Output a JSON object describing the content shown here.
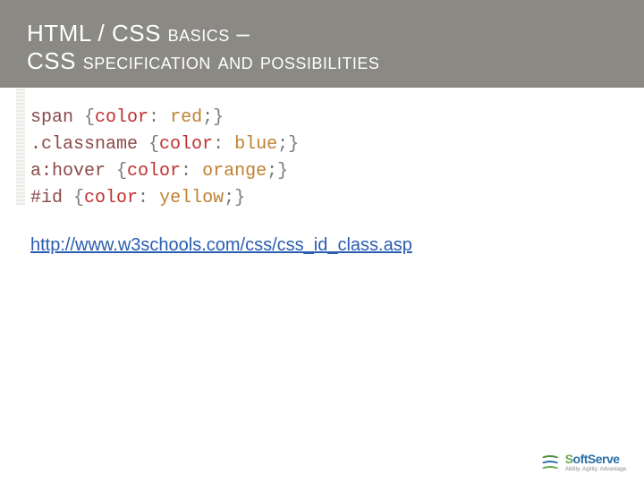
{
  "header": {
    "line1_pre": "HTML / CSS ",
    "line1_sc": "basics",
    "line1_post": " – ",
    "line2_pre": "CSS ",
    "line2_sc": "specification and possibilities"
  },
  "code": {
    "l1": {
      "sel": "span ",
      "open": "{",
      "prop": "color",
      "colon": ": ",
      "val": "red",
      "semi": ";",
      "close": "}"
    },
    "l2": {
      "sel": ".classname ",
      "open": "{",
      "prop": "color",
      "colon": ": ",
      "val": "blue",
      "semi": ";",
      "close": "}"
    },
    "l3": {
      "sel": "a:hover ",
      "open": "{",
      "prop": "color",
      "colon": ": ",
      "val": "orange",
      "semi": ";",
      "close": "}"
    },
    "l4": {
      "sel": "#id ",
      "open": "{",
      "prop": "color",
      "colon": ": ",
      "val": "yellow",
      "semi": ";",
      "close": "}"
    }
  },
  "link": {
    "text": "http://www.w3schools.com/css/css_id_class.asp",
    "href": "http://www.w3schools.com/css/css_id_class.asp"
  },
  "brand": {
    "name_s": "S",
    "name_rest": "oftServe",
    "tagline": "Ability. Agility. Advantage."
  }
}
